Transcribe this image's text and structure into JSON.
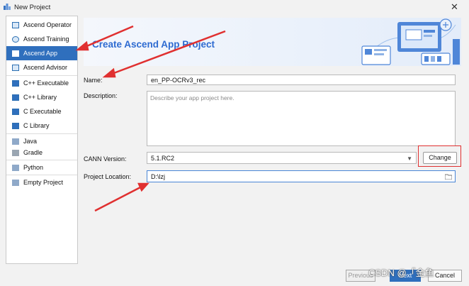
{
  "window": {
    "title": "New Project"
  },
  "sidebar": {
    "items": [
      {
        "label": "Ascend Operator",
        "icon": "ascend-operator-icon"
      },
      {
        "label": "Ascend Training",
        "icon": "ascend-training-icon"
      },
      {
        "label": "Ascend App",
        "icon": "ascend-app-icon",
        "selected": true
      },
      {
        "label": "Ascend Advisor",
        "icon": "ascend-advisor-icon"
      },
      {
        "label": "C++ Executable",
        "icon": "cpp-executable-icon"
      },
      {
        "label": "C++ Library",
        "icon": "cpp-library-icon"
      },
      {
        "label": "C Executable",
        "icon": "c-executable-icon"
      },
      {
        "label": "C Library",
        "icon": "c-library-icon"
      },
      {
        "label": "Java",
        "icon": "java-icon"
      },
      {
        "label": "Gradle",
        "icon": "gradle-icon"
      },
      {
        "label": "Python",
        "icon": "python-icon"
      },
      {
        "label": "Empty Project",
        "icon": "empty-project-icon"
      }
    ]
  },
  "banner": {
    "title": "Create Ascend App Project"
  },
  "form": {
    "name_label": "Name:",
    "name_value": "en_PP-OCRv3_rec",
    "description_label": "Description:",
    "description_placeholder": "Describe your app project here.",
    "cann_label": "CANN Version:",
    "cann_value": "5.1.RC2",
    "change_label": "Change",
    "location_label": "Project Location:",
    "location_value": "D:\\lzj"
  },
  "footer": {
    "previous_label": "Previous",
    "next_label": "Next",
    "cancel_label": "Cancel"
  },
  "watermark": "CSDN @「金鱼",
  "colors": {
    "accent": "#2f6fbd",
    "annotation": "#e03030",
    "banner_title": "#2e6bd1"
  }
}
